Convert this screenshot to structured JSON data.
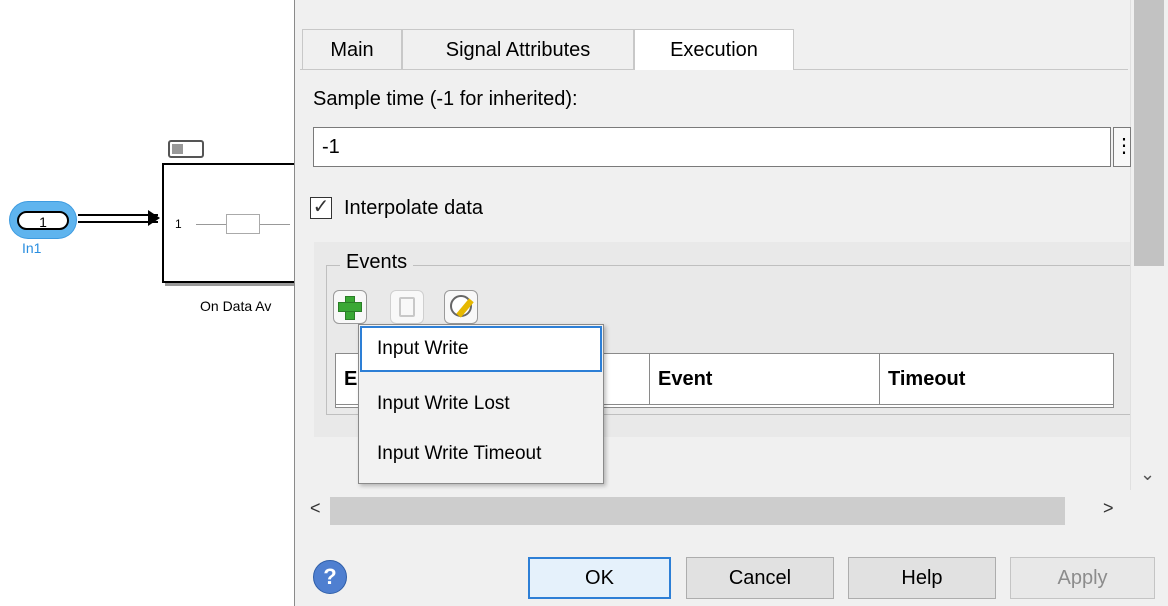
{
  "canvas": {
    "inport_number": "1",
    "inport_name": "In1",
    "subsystem_port": "1",
    "subsystem_name": "On Data Av"
  },
  "dialog": {
    "tabs": [
      {
        "label": "Main",
        "active": false
      },
      {
        "label": "Signal Attributes",
        "active": false
      },
      {
        "label": "Execution",
        "active": true
      }
    ],
    "sample_time_label": "Sample time (-1 for inherited):",
    "sample_time_value": "-1",
    "sample_time_button": "⋮",
    "interpolate_label": "Interpolate data",
    "interpolate_checked": true,
    "events_title": "Events",
    "events_table": {
      "columns": [
        "E",
        "Event",
        "Timeout"
      ]
    },
    "dropdown": {
      "items": [
        {
          "label": "Input Write",
          "selected": true
        },
        {
          "label": "Input Write Lost",
          "selected": false
        },
        {
          "label": "Input Write Timeout",
          "selected": false
        }
      ]
    },
    "scroll": {
      "left": "<",
      "right": ">",
      "down": "⌄"
    },
    "buttons": {
      "help_icon": "?",
      "ok": "OK",
      "cancel": "Cancel",
      "help": "Help",
      "apply": "Apply"
    }
  },
  "colors": {
    "accent": "#2d7fd6",
    "inport_highlight": "#5fb4ee",
    "add_icon": "#3aa835"
  }
}
